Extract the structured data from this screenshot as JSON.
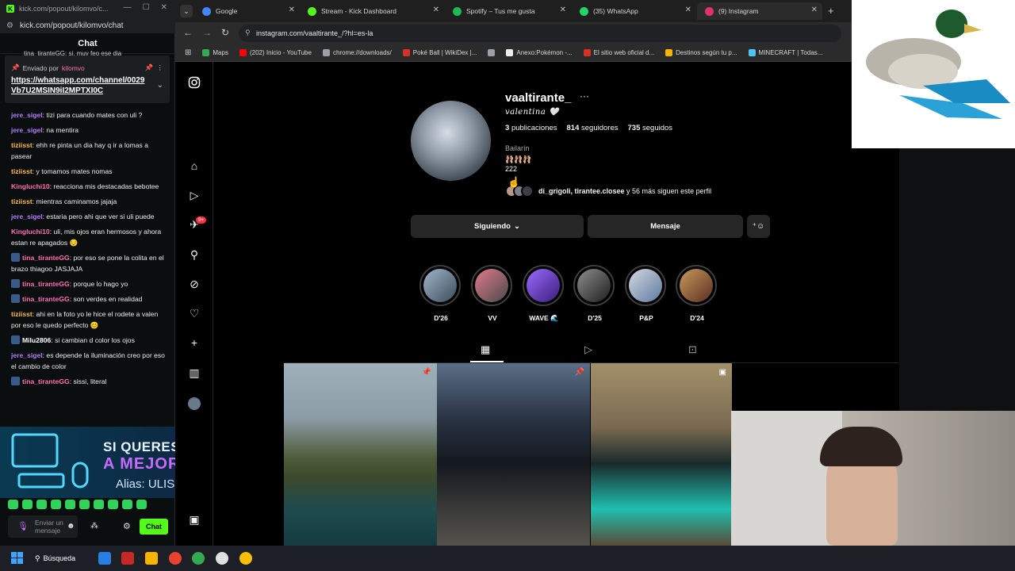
{
  "chat_window": {
    "title": "kick.com/popout/kilomvo/c...",
    "url": "kick.com/popout/kilomvo/chat",
    "header": "Chat",
    "top_cut_msg": "tina_tiranteGG: si, muy feo ese dia",
    "pinned": {
      "by_label": "Enviado por",
      "by_user": "kilomvo",
      "link": "https://whatsapp.com/channel/0029Vb7U2MSIN9iI2MPTXI0C"
    },
    "messages": [
      {
        "user": "jere_sigel",
        "color": "#b37bff",
        "badge": false,
        "text": ": tizi para cuando mates con uli ?"
      },
      {
        "user": "jere_sigel",
        "color": "#b37bff",
        "badge": false,
        "text": ": na mentira"
      },
      {
        "user": "tiziisst",
        "color": "#ffb84d",
        "badge": false,
        "text": ": ehh re pinta un dia hay q ir a lomas a pasear"
      },
      {
        "user": "tiziisst",
        "color": "#ffb84d",
        "badge": false,
        "text": ": y tomamos mates nomas"
      },
      {
        "user": "Kingluchi10",
        "color": "#ff6fb1",
        "badge": false,
        "text": ": reacciona mis destacadas bebotee"
      },
      {
        "user": "tiziisst",
        "color": "#ffb84d",
        "badge": false,
        "text": ": mientras caminamos jajaja"
      },
      {
        "user": "jere_sigel",
        "color": "#b37bff",
        "badge": false,
        "text": ": estaria pero ahi que ver si uli puede"
      },
      {
        "user": "Kingluchi10",
        "color": "#ff6fb1",
        "badge": false,
        "text": ": uli, mis ojos eran hermosos y ahora estan re apagados 😔"
      },
      {
        "user": "tina_tiranteGG",
        "color": "#ff6fb1",
        "badge": true,
        "text": ": por eso se pone la colita en el brazo thiagoo JASJAJA"
      },
      {
        "user": "tina_tiranteGG",
        "color": "#ff6fb1",
        "badge": true,
        "text": ": porque lo hago yo"
      },
      {
        "user": "tina_tiranteGG",
        "color": "#ff6fb1",
        "badge": true,
        "text": ": son verdes en realidad"
      },
      {
        "user": "tiziisst",
        "color": "#ffb84d",
        "badge": false,
        "text": ": ahi en la foto yo le hice el rodete a valen por eso le quedo perfecto 😊"
      },
      {
        "user": "Milu2806",
        "color": "#ffffff",
        "badge": true,
        "text": ": si cambian d color los ojos"
      },
      {
        "user": "jere_sigel",
        "color": "#b37bff",
        "badge": false,
        "text": ": es depende la iluminación creo por eso el cambio de color"
      },
      {
        "user": "tina_tiranteGG",
        "color": "#ff6fb1",
        "badge": true,
        "text": ": sissi, literal"
      }
    ],
    "promo": {
      "line1": "SI QUERES AYUDARME",
      "line2": "A MEJORAR MI PC",
      "line3": "Alias: ULISES.KLV"
    },
    "input_placeholder": "Enviar un mensaje",
    "send_label": "Chat"
  },
  "browser": {
    "tabs": [
      {
        "label": "Google",
        "color": "#4285f4",
        "active": false
      },
      {
        "label": "Stream - Kick Dashboard",
        "color": "#53fc18",
        "active": false
      },
      {
        "label": "Spotify – Tus me gusta",
        "color": "#1db954",
        "active": false
      },
      {
        "label": "(35) WhatsApp",
        "color": "#25d366",
        "active": false
      },
      {
        "label": "(9) Instagram",
        "color": "#e1306c",
        "active": true
      }
    ],
    "url": "instagram.com/vaaltirante_/?hl=es-la",
    "bookmarks": [
      {
        "label": "Maps",
        "color": "#34a853"
      },
      {
        "label": "(202) Inicio - YouTube",
        "color": "#ff0000"
      },
      {
        "label": "chrome://downloads/",
        "color": "#9aa0a6"
      },
      {
        "label": "Poké Ball | WikiDex |...",
        "color": "#d93025"
      },
      {
        "label": "",
        "color": "#9aa0a6"
      },
      {
        "label": "Anexo:Pokémon -...",
        "color": "#eeeeee"
      },
      {
        "label": "El sitio web oficial d...",
        "color": "#d93025"
      },
      {
        "label": "Destinos según tu p...",
        "color": "#f4b400"
      },
      {
        "label": "MINECRAFT | Todas...",
        "color": "#4fc3f7"
      }
    ]
  },
  "profile": {
    "username": "vaaltirante_",
    "more": "···",
    "full_name": "valentina 🤍",
    "posts_n": "3",
    "posts_l": "publicaciones",
    "followers_n": "814",
    "followers_l": "seguidores",
    "following_n": "735",
    "following_l": "seguidos",
    "category": "Bailarín",
    "bio_emojis": "🩰🩰🩰",
    "bio_num": "222",
    "mutual_users": "di_grigoli, tirantee.closee",
    "mutual_rest": " y 56 más siguen este perfil",
    "btn_following": "Siguiendo",
    "btn_message": "Mensaje",
    "highlights": [
      {
        "label": "D'26",
        "color1": "#9fb6c9",
        "color2": "#3d4d5c"
      },
      {
        "label": "VV",
        "color1": "#e07a8a",
        "color2": "#4a4a4a"
      },
      {
        "label": "WAVE 🌊",
        "color1": "#9b6bff",
        "color2": "#3a1d7a"
      },
      {
        "label": "D'25",
        "color1": "#8e8e8e",
        "color2": "#1e1e1e"
      },
      {
        "label": "P&P",
        "color1": "#d4d8de",
        "color2": "#5c7aa3"
      },
      {
        "label": "D'24",
        "color1": "#c79a5b",
        "color2": "#5a2e22"
      }
    ],
    "notif_count": "9+"
  },
  "taskbar": {
    "search_label": "Búsqueda"
  }
}
